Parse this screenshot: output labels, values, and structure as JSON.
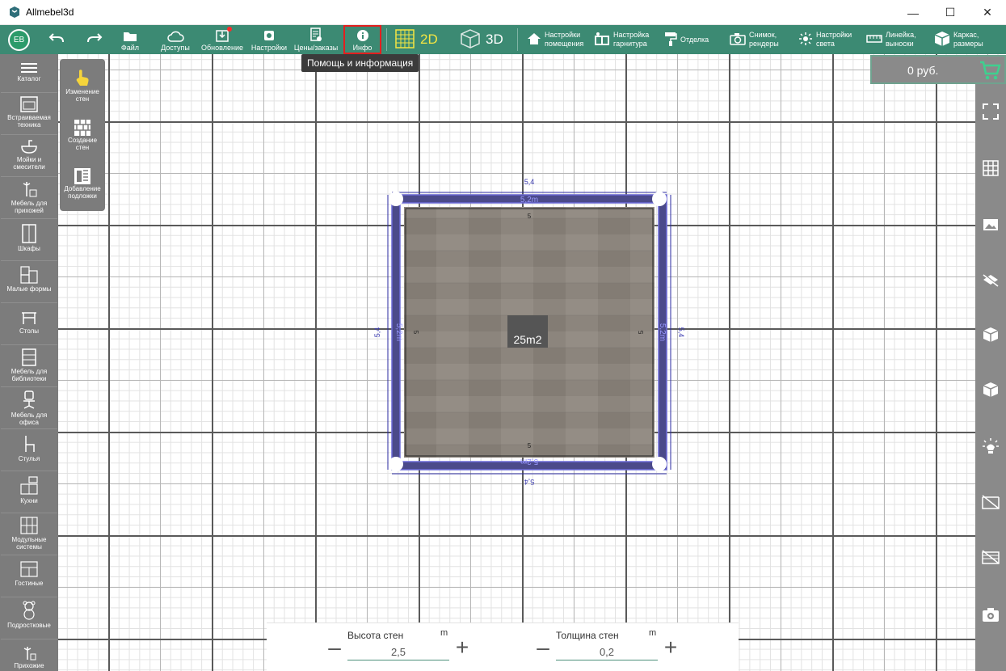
{
  "window": {
    "title": "Allmebel3d",
    "controls": [
      "minimize",
      "maximize",
      "close"
    ]
  },
  "toolbar": {
    "avatar": "ЕВ",
    "undo_icon": "undo-icon",
    "redo_icon": "redo-icon",
    "items": [
      {
        "label": "Файл",
        "icon": "folder-icon"
      },
      {
        "label": "Доступы",
        "icon": "cloud-icon"
      },
      {
        "label": "Обновление",
        "icon": "download-icon",
        "badge": true
      },
      {
        "label": "Настройки",
        "icon": "gear-icon"
      },
      {
        "label": "Цены/заказы",
        "icon": "prices-icon"
      },
      {
        "label": "Инфо",
        "icon": "info-icon",
        "highlighted": true
      }
    ],
    "mode_2d": "2D",
    "mode_3d": "3D",
    "right_items": [
      {
        "line1": "Настройки",
        "line2": "помещения",
        "icon": "home-icon"
      },
      {
        "line1": "Настройка",
        "line2": "гарнитура",
        "icon": "cabinet-icon"
      },
      {
        "line1": "Отделка",
        "line2": "",
        "icon": "paint-roller-icon"
      },
      {
        "line1": "Снимок,",
        "line2": "рендеры",
        "icon": "camera-icon"
      },
      {
        "line1": "Настройки",
        "line2": "света",
        "icon": "light-icon"
      },
      {
        "line1": "Линейка,",
        "line2": "выноски",
        "icon": "ruler-icon"
      },
      {
        "line1": "Каркас,",
        "line2": "размеры",
        "icon": "box-icon"
      }
    ],
    "tooltip": "Помощь и информация"
  },
  "left_sidebar": [
    {
      "label": "Каталог"
    },
    {
      "label": "Встраиваемая техника"
    },
    {
      "label": "Мойки и смесители"
    },
    {
      "label": "Мебель для прихожей"
    },
    {
      "label": "Шкафы"
    },
    {
      "label": "Малые формы"
    },
    {
      "label": "Столы"
    },
    {
      "label": "Мебель для библиотеки"
    },
    {
      "label": "Мебель для офиса"
    },
    {
      "label": "Стулья"
    },
    {
      "label": "Кухни"
    },
    {
      "label": "Модульные системы"
    },
    {
      "label": "Гостиные"
    },
    {
      "label": "Подростковые"
    },
    {
      "label": "Прихожие"
    }
  ],
  "wall_tools": [
    {
      "label": "Изменение стен",
      "icon": "hand-pointer-icon"
    },
    {
      "label": "Создание стен",
      "icon": "brick-wall-icon"
    },
    {
      "label": "Добавление подложки",
      "icon": "underlay-icon"
    }
  ],
  "price": {
    "value": "0 руб.",
    "icon": "cart-icon"
  },
  "right_sidebar": [
    "fullscreen-icon",
    "grid-icon",
    "image-icon",
    "hide-objects-icon",
    "box-open-icon",
    "cube-icon",
    "lamp-icon",
    "wall-hide-icon",
    "wall-strike-icon",
    "add-camera-icon"
  ],
  "plan": {
    "area": "25m2",
    "outer_dim": "5,4",
    "wall_len": "5,2m",
    "inner_dim": "5",
    "floor_color": "#8a847c",
    "wall_color": "#4a4a8c"
  },
  "bottom_panel": {
    "height": {
      "label": "Высота стен",
      "unit": "m",
      "value": "2,5"
    },
    "thickness": {
      "label": "Толщина стен",
      "unit": "m",
      "value": "0,2"
    }
  }
}
